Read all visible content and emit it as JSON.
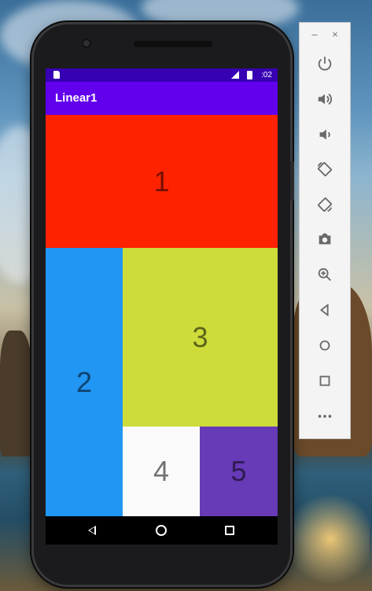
{
  "status_bar": {
    "time": ":02"
  },
  "app_bar": {
    "title": "Linear1"
  },
  "blocks": [
    {
      "label": "1",
      "color": "#ff2200"
    },
    {
      "label": "2",
      "color": "#2196f3"
    },
    {
      "label": "3",
      "color": "#cddc39"
    },
    {
      "label": "4",
      "color": "#fafafa"
    },
    {
      "label": "5",
      "color": "#673ab7"
    }
  ],
  "emulator_panel": {
    "window_controls": {
      "minimize": "–",
      "close": "×"
    },
    "buttons": [
      "power-icon",
      "volume-up-icon",
      "volume-down-icon",
      "rotate-left-icon",
      "rotate-right-icon",
      "camera-icon",
      "zoom-icon",
      "back-icon",
      "home-icon",
      "overview-icon",
      "more-icon"
    ]
  },
  "colors": {
    "status_bar": "#3700b3",
    "app_bar": "#6200ee",
    "panel_icon": "#6a6a6a"
  }
}
